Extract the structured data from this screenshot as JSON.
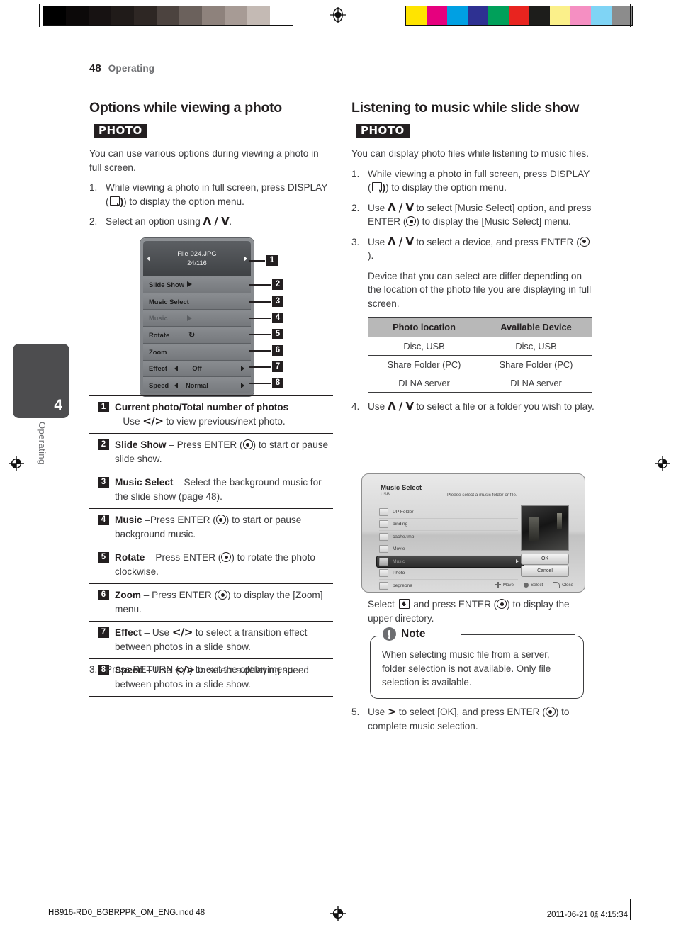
{
  "print_marks": {
    "grayscale": [
      "#000000",
      "#0c0909",
      "#171212",
      "#201b19",
      "#2e2724",
      "#4c433f",
      "#6b615c",
      "#8e827c",
      "#a79b95",
      "#c4bab4",
      "#ffffff"
    ],
    "colors": [
      "#ffe400",
      "#e6007e",
      "#00a0e3",
      "#2e3192",
      "#00a05a",
      "#e8241f",
      "#1d1d1b",
      "#fbf08a",
      "#f58fc2",
      "#7fd4f5",
      "#8c8c8c"
    ]
  },
  "folio": {
    "page_number": "48",
    "section": "Operating"
  },
  "chapter_tab": {
    "number": "4",
    "label": "Operating"
  },
  "left_column": {
    "heading": "Options while viewing a photo",
    "media_badge": "PHOTO",
    "intro": "You can use various options during viewing a photo in full screen.",
    "steps": [
      {
        "n": "1.",
        "text_a": "While viewing a photo in full screen, press DISPLAY (",
        "text_b": ") to display the option menu."
      },
      {
        "n": "2.",
        "text_a": "Select an option using ",
        "arrows": "Λ / V",
        "text_b": "."
      }
    ],
    "final_step": {
      "n": "3.",
      "text_a": "Press RETURN (",
      "text_b": ") to exit the option menu."
    }
  },
  "osd_menu": {
    "file_name": "File 024.JPG",
    "counter": "24/116",
    "rows": [
      {
        "label": "Slide Show",
        "value": "",
        "icon": "play-icon",
        "dim": false
      },
      {
        "label": "Music Select",
        "value": "",
        "icon": "none",
        "dim": false
      },
      {
        "label": "Music",
        "value": "",
        "icon": "play-icon",
        "dim": true
      },
      {
        "label": "Rotate",
        "value": "",
        "icon": "rotate-icon",
        "dim": false
      },
      {
        "label": "Zoom",
        "value": "",
        "icon": "none",
        "dim": false
      },
      {
        "label": "Effect",
        "value": "Off",
        "icon": "lr-arrows",
        "dim": false
      },
      {
        "label": "Speed",
        "value": "Normal",
        "icon": "lr-arrows",
        "dim": false
      }
    ],
    "callout_numbers": [
      "1",
      "2",
      "3",
      "4",
      "5",
      "6",
      "7",
      "8"
    ]
  },
  "legend": [
    {
      "n": "1",
      "title": "Current photo/Total number of photos",
      "dash": "",
      "rest_a": "– Use ",
      "arrows": "</>",
      "rest_b": " to view previous/next photo."
    },
    {
      "n": "2",
      "title": "Slide Show",
      "rest_a": " – Press ENTER (",
      "rest_b": ") to start or pause slide show."
    },
    {
      "n": "3",
      "title": "Music Select",
      "rest_a": " – Select the background music for the slide show (page 48).",
      "rest_b": ""
    },
    {
      "n": "4",
      "title": "Music",
      "rest_a": " –Press ENTER (",
      "rest_b": ") to start or pause background music."
    },
    {
      "n": "5",
      "title": "Rotate",
      "rest_a": " – Press ENTER (",
      "rest_b": ") to rotate the photo clockwise."
    },
    {
      "n": "6",
      "title": "Zoom",
      "rest_a": " – Press ENTER (",
      "rest_b": ") to display the [Zoom] menu."
    },
    {
      "n": "7",
      "title": "Effect",
      "rest_a": " – Use ",
      "arrows": "</>",
      "rest_b": " to select a transition effect between photos in a slide show."
    },
    {
      "n": "8",
      "title": "Speed",
      "rest_a": " – Use ",
      "arrows": "</>",
      "rest_b": " to select a delaying speed between photos in a slide show."
    }
  ],
  "right_column": {
    "heading": "Listening to music while slide show",
    "media_badge": "PHOTO",
    "intro": "You can display photo files while listening to music files.",
    "step1": {
      "n": "1.",
      "a": "While viewing a photo in full screen, press DISPLAY (",
      "b": ") to display the option menu."
    },
    "step2": {
      "n": "2.",
      "a": "Use ",
      "arrows": "Λ / V",
      "b": " to select [Music Select] option, and press ENTER (",
      "c": ") to display the [Music Select] menu."
    },
    "step3": {
      "n": "3.",
      "a": "Use ",
      "arrows": "Λ / V",
      "b": " to select a device, and press ENTER (",
      "c": ")."
    },
    "step3_note": "Device that you can select are differ depending on the location of the photo file you are displaying in full screen.",
    "step4": {
      "n": "4.",
      "a": "Use ",
      "arrows": "Λ / V",
      "b": " to select a file or a folder you wish to play."
    },
    "after_figure": {
      "a": "Select ",
      "b": " and press ENTER (",
      "c": ") to display the upper directory."
    },
    "step5": {
      "n": "5.",
      "a": "Use ",
      "arrows": ">",
      "b": " to select [OK], and press ENTER (",
      "c": ") to complete music selection."
    }
  },
  "device_table": {
    "headers": [
      "Photo location",
      "Available Device"
    ],
    "rows": [
      [
        "Disc, USB",
        "Disc, USB"
      ],
      [
        "Share Folder (PC)",
        "Share Folder (PC)"
      ],
      [
        "DLNA server",
        "DLNA server"
      ]
    ]
  },
  "music_select_dialog": {
    "title": "Music Select",
    "subtitle": "USB",
    "hint": "Please select a music folder or file.",
    "items": [
      {
        "name": "UP Folder",
        "icon": "up-folder-icon",
        "selected": false
      },
      {
        "name": "binding",
        "icon": "folder-icon",
        "selected": false
      },
      {
        "name": "cache.tmp",
        "icon": "folder-icon",
        "selected": false
      },
      {
        "name": "Movie",
        "icon": "folder-icon",
        "selected": false
      },
      {
        "name": "Music",
        "icon": "folder-icon",
        "selected": true
      },
      {
        "name": "Photo",
        "icon": "folder-icon",
        "selected": false
      },
      {
        "name": "pegreona",
        "icon": "folder-icon",
        "selected": false
      }
    ],
    "buttons": {
      "ok": "OK",
      "cancel": "Cancel"
    },
    "bottom_bar": [
      {
        "icon": "dpad-icon",
        "label": "Move"
      },
      {
        "icon": "enter-icon",
        "label": "Select"
      },
      {
        "icon": "return-icon",
        "label": "Close"
      }
    ]
  },
  "note": {
    "title": "Note",
    "body": "When selecting music file from a server, folder selection is not available. Only file selection is available."
  },
  "footer": {
    "left": "HB916-RD0_BGBRPPK_OM_ENG.indd   48",
    "right": "2011-06-21   ㍘ 4:15:34"
  }
}
